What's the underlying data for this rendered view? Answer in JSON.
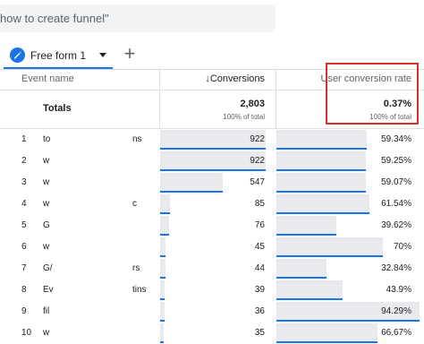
{
  "search": {
    "text": "how to create funnel\""
  },
  "tab": {
    "label": "Free form 1"
  },
  "headers": {
    "event_name": "Event name",
    "conversions": "↓Conversions",
    "user_conversion_rate": "User conversion rate"
  },
  "totals": {
    "label": "Totals",
    "conversions": "2,803",
    "conversions_sub": "100% of total",
    "rate": "0.37%",
    "rate_sub": "100% of total"
  },
  "rows": [
    {
      "num": "1",
      "name": "to",
      "tail": "ns",
      "conversions": "922",
      "rate": "59.34%",
      "conv_frac": 1.0,
      "rate_frac": 0.629
    },
    {
      "num": "2",
      "name": "w",
      "tail": "",
      "conversions": "922",
      "rate": "59.25%",
      "conv_frac": 1.0,
      "rate_frac": 0.628
    },
    {
      "num": "3",
      "name": "w",
      "tail": "",
      "conversions": "547",
      "rate": "59.07%",
      "conv_frac": 0.593,
      "rate_frac": 0.626
    },
    {
      "num": "4",
      "name": "w",
      "tail": "c",
      "conversions": "85",
      "rate": "61.54%",
      "conv_frac": 0.092,
      "rate_frac": 0.652
    },
    {
      "num": "5",
      "name": "G",
      "tail": "",
      "conversions": "76",
      "rate": "39.62%",
      "conv_frac": 0.082,
      "rate_frac": 0.42
    },
    {
      "num": "6",
      "name": "w",
      "tail": "",
      "conversions": "45",
      "rate": "70%",
      "conv_frac": 0.049,
      "rate_frac": 0.742
    },
    {
      "num": "7",
      "name": "G/",
      "tail": "rs",
      "conversions": "44",
      "rate": "32.84%",
      "conv_frac": 0.048,
      "rate_frac": 0.348
    },
    {
      "num": "8",
      "name": "Ev",
      "tail": "tins",
      "conversions": "39",
      "rate": "43.9%",
      "conv_frac": 0.042,
      "rate_frac": 0.465
    },
    {
      "num": "9",
      "name": "fil",
      "tail": "",
      "conversions": "36",
      "rate": "94.29%",
      "conv_frac": 0.039,
      "rate_frac": 1.0
    },
    {
      "num": "10",
      "name": "w",
      "tail": "",
      "conversions": "35",
      "rate": "66.67%",
      "conv_frac": 0.038,
      "rate_frac": 0.707
    }
  ]
}
